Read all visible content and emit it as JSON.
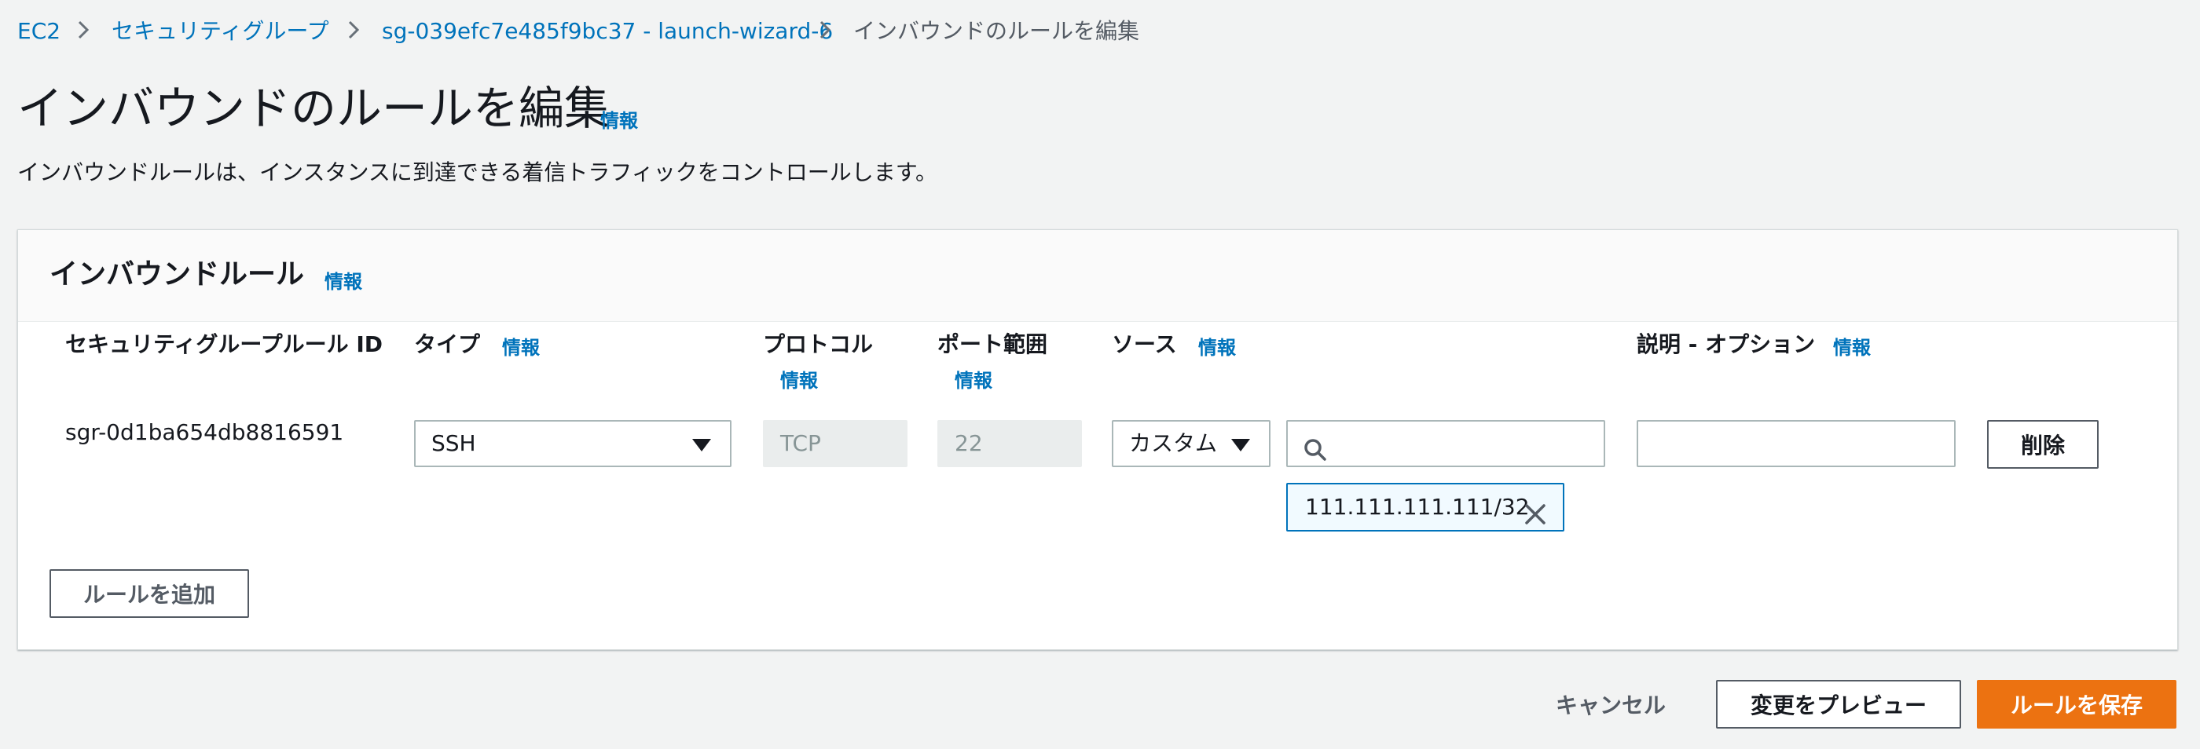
{
  "breadcrumb": {
    "items": [
      "EC2",
      "セキュリティグループ",
      "sg-039efc7e485f9bc37 - launch-wizard-6",
      "インバウンドのルールを編集"
    ]
  },
  "page": {
    "title": "インバウンドのルールを編集",
    "info": "情報",
    "subtitle": "インバウンドルールは、インスタンスに到達できる着信トラフィックをコントロールします。"
  },
  "panel": {
    "title": "インバウンドルール",
    "info": "情報",
    "columns": {
      "rule_id": "セキュリティグループルール ID",
      "type": "タイプ",
      "protocol": "プロトコル",
      "port_range": "ポート範囲",
      "source": "ソース",
      "description": "説明 - オプション",
      "info": "情報"
    },
    "rows": [
      {
        "rule_id": "sgr-0d1ba654db8816591",
        "type": "SSH",
        "protocol": "TCP",
        "port_range": "22",
        "source_type": "カスタム",
        "source_search": "",
        "source_token": "111.111.111.111/32",
        "description": "",
        "delete_label": "削除"
      }
    ],
    "add_rule_label": "ルールを追加"
  },
  "footer": {
    "cancel_label": "キャンセル",
    "preview_label": "変更をプレビュー",
    "save_label": "ルールを保存"
  },
  "colors": {
    "link": "#0073bb",
    "primary_button": "#ec7211",
    "background": "#f2f3f3"
  },
  "icons": [
    "chevron-right-icon",
    "caret-down-icon",
    "search-icon",
    "close-icon"
  ]
}
